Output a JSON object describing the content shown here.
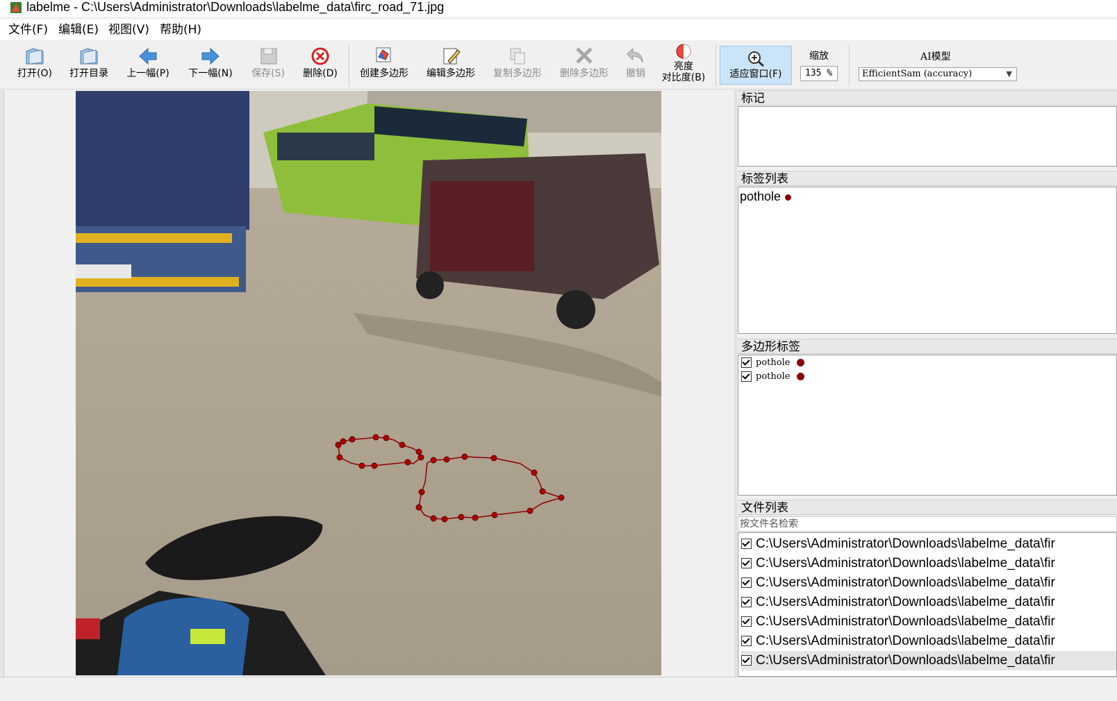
{
  "window": {
    "title": "labelme - C:\\Users\\Administrator\\Downloads\\labelme_data\\firc_road_71.jpg"
  },
  "menu": [
    "文件(F)",
    "编辑(E)",
    "视图(V)",
    "帮助(H)"
  ],
  "toolbar": {
    "open": "打开(O)",
    "open_dir": "打开目录",
    "prev": "上一幅(P)",
    "next": "下一幅(N)",
    "save": "保存(S)",
    "delete": "删除(D)",
    "create_polygon": "创建多边形",
    "edit_polygon": "编辑多边形",
    "copy_polygon": "复制多边形",
    "delete_polygon": "删除多边形",
    "undo": "撤销",
    "brightness_1": "亮度",
    "brightness_2": "对比度(B)",
    "fit_window": "适应窗口(F)",
    "zoom_label": "缩放",
    "zoom_value": "135 %",
    "ai_label": "AI模型",
    "ai_value": "EfficientSam (accuracy)"
  },
  "docks": {
    "flags_title": "标记",
    "labels_title": "标签列表",
    "label_items": [
      "pothole"
    ],
    "polygons_title": "多边形标签",
    "polygon_items": [
      "pothole",
      "pothole"
    ],
    "files_title": "文件列表",
    "file_search_placeholder": "按文件名检索",
    "file_items": [
      "C:\\Users\\Administrator\\Downloads\\labelme_data\\fir",
      "C:\\Users\\Administrator\\Downloads\\labelme_data\\fir",
      "C:\\Users\\Administrator\\Downloads\\labelme_data\\fir",
      "C:\\Users\\Administrator\\Downloads\\labelme_data\\fir",
      "C:\\Users\\Administrator\\Downloads\\labelme_data\\fir",
      "C:\\Users\\Administrator\\Downloads\\labelme_data\\fir",
      "C:\\Users\\Administrator\\Downloads\\labelme_data\\fir"
    ]
  },
  "colors": {
    "label_color": "#8b0000",
    "active_tool_bg": "#cce4f7"
  }
}
